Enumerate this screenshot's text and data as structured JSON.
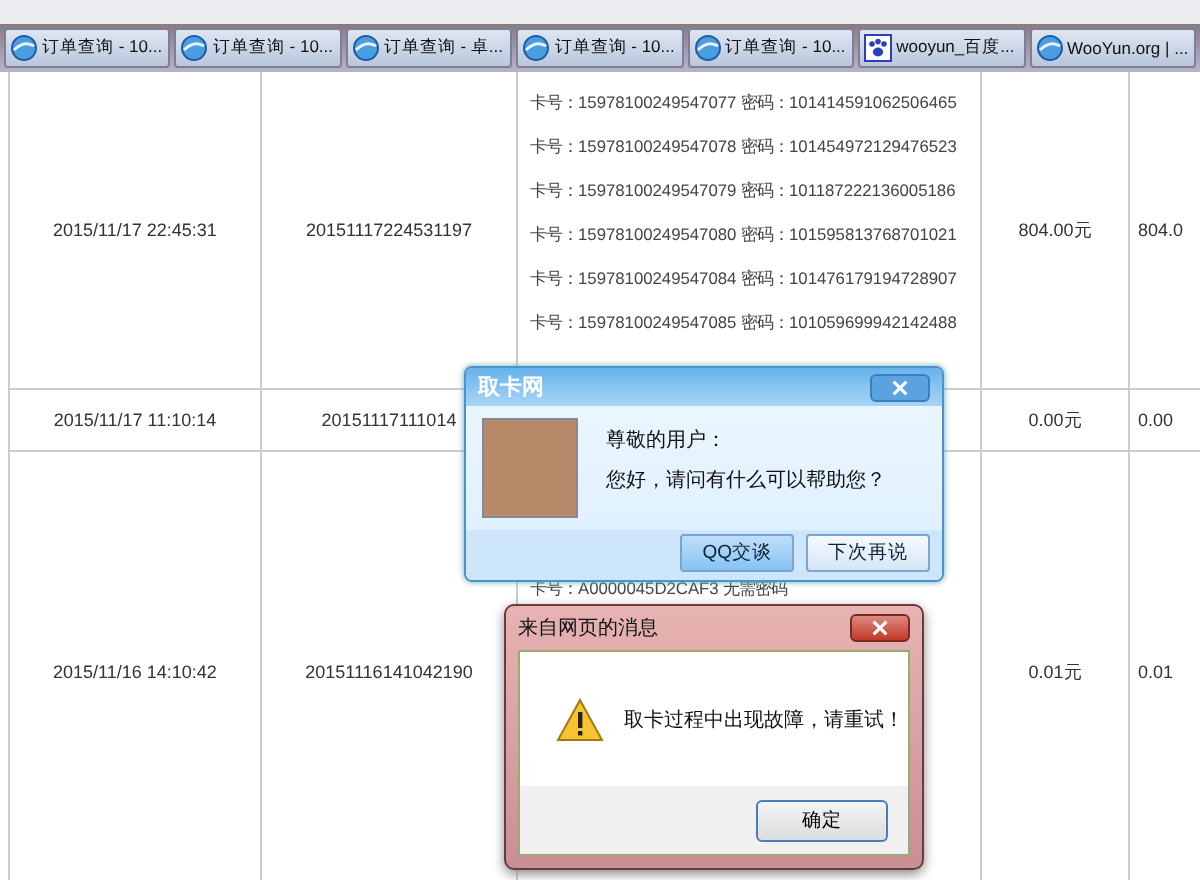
{
  "taskbar": {
    "tabs": [
      {
        "label": "订单查询 - 10...",
        "kind": "globe",
        "selected": false
      },
      {
        "label": "订单查询 - 10...",
        "kind": "globe",
        "selected": false
      },
      {
        "label": "订单查询 - 卓...",
        "kind": "globe",
        "selected": false
      },
      {
        "label": "订单查询 - 10...",
        "kind": "globe",
        "selected": false
      },
      {
        "label": "订单查询 - 10...",
        "kind": "globe",
        "selected": false
      },
      {
        "label": "wooyun_百度...",
        "kind": "paw",
        "selected": false
      },
      {
        "label": "WooYun.org | ...",
        "kind": "globe",
        "selected": false
      }
    ]
  },
  "table": {
    "rows": [
      {
        "time": "2015/11/17 22:45:31",
        "order": "20151117224531197",
        "cards": [
          "卡号：15978100249547077 密码：101414591062506465",
          "卡号：15978100249547078 密码：101454972129476523",
          "卡号：15978100249547079 密码：101187222136005186",
          "卡号：15978100249547080 密码：101595813768701021",
          "卡号：15978100249547084 密码：101476179194728907",
          "卡号：15978100249547085 密码：101059699942142488"
        ],
        "amount": "804.00元",
        "column_5": "804.0"
      },
      {
        "time": "2015/11/17 11:10:14",
        "order": "20151117111014",
        "cards": [],
        "amount": "0.00元",
        "column_5": "0.00"
      },
      {
        "time": "2015/11/16 14:10:42",
        "order": "20151116141042190",
        "cards": [
          "卡号：A0000045D2CAF3 无需密码"
        ],
        "amount": "0.01元",
        "column_5": "0.01"
      }
    ]
  },
  "chat_popup": {
    "title": "取卡网",
    "greeting": "尊敬的用户：",
    "message": "您好，请问有什么可以帮助您？",
    "buttons": [
      "QQ交谈",
      "下次再说"
    ]
  },
  "alert_dialog": {
    "title": "来自网页的消息",
    "message": "取卡过程中出现故障，请重试！",
    "button": "确定"
  }
}
